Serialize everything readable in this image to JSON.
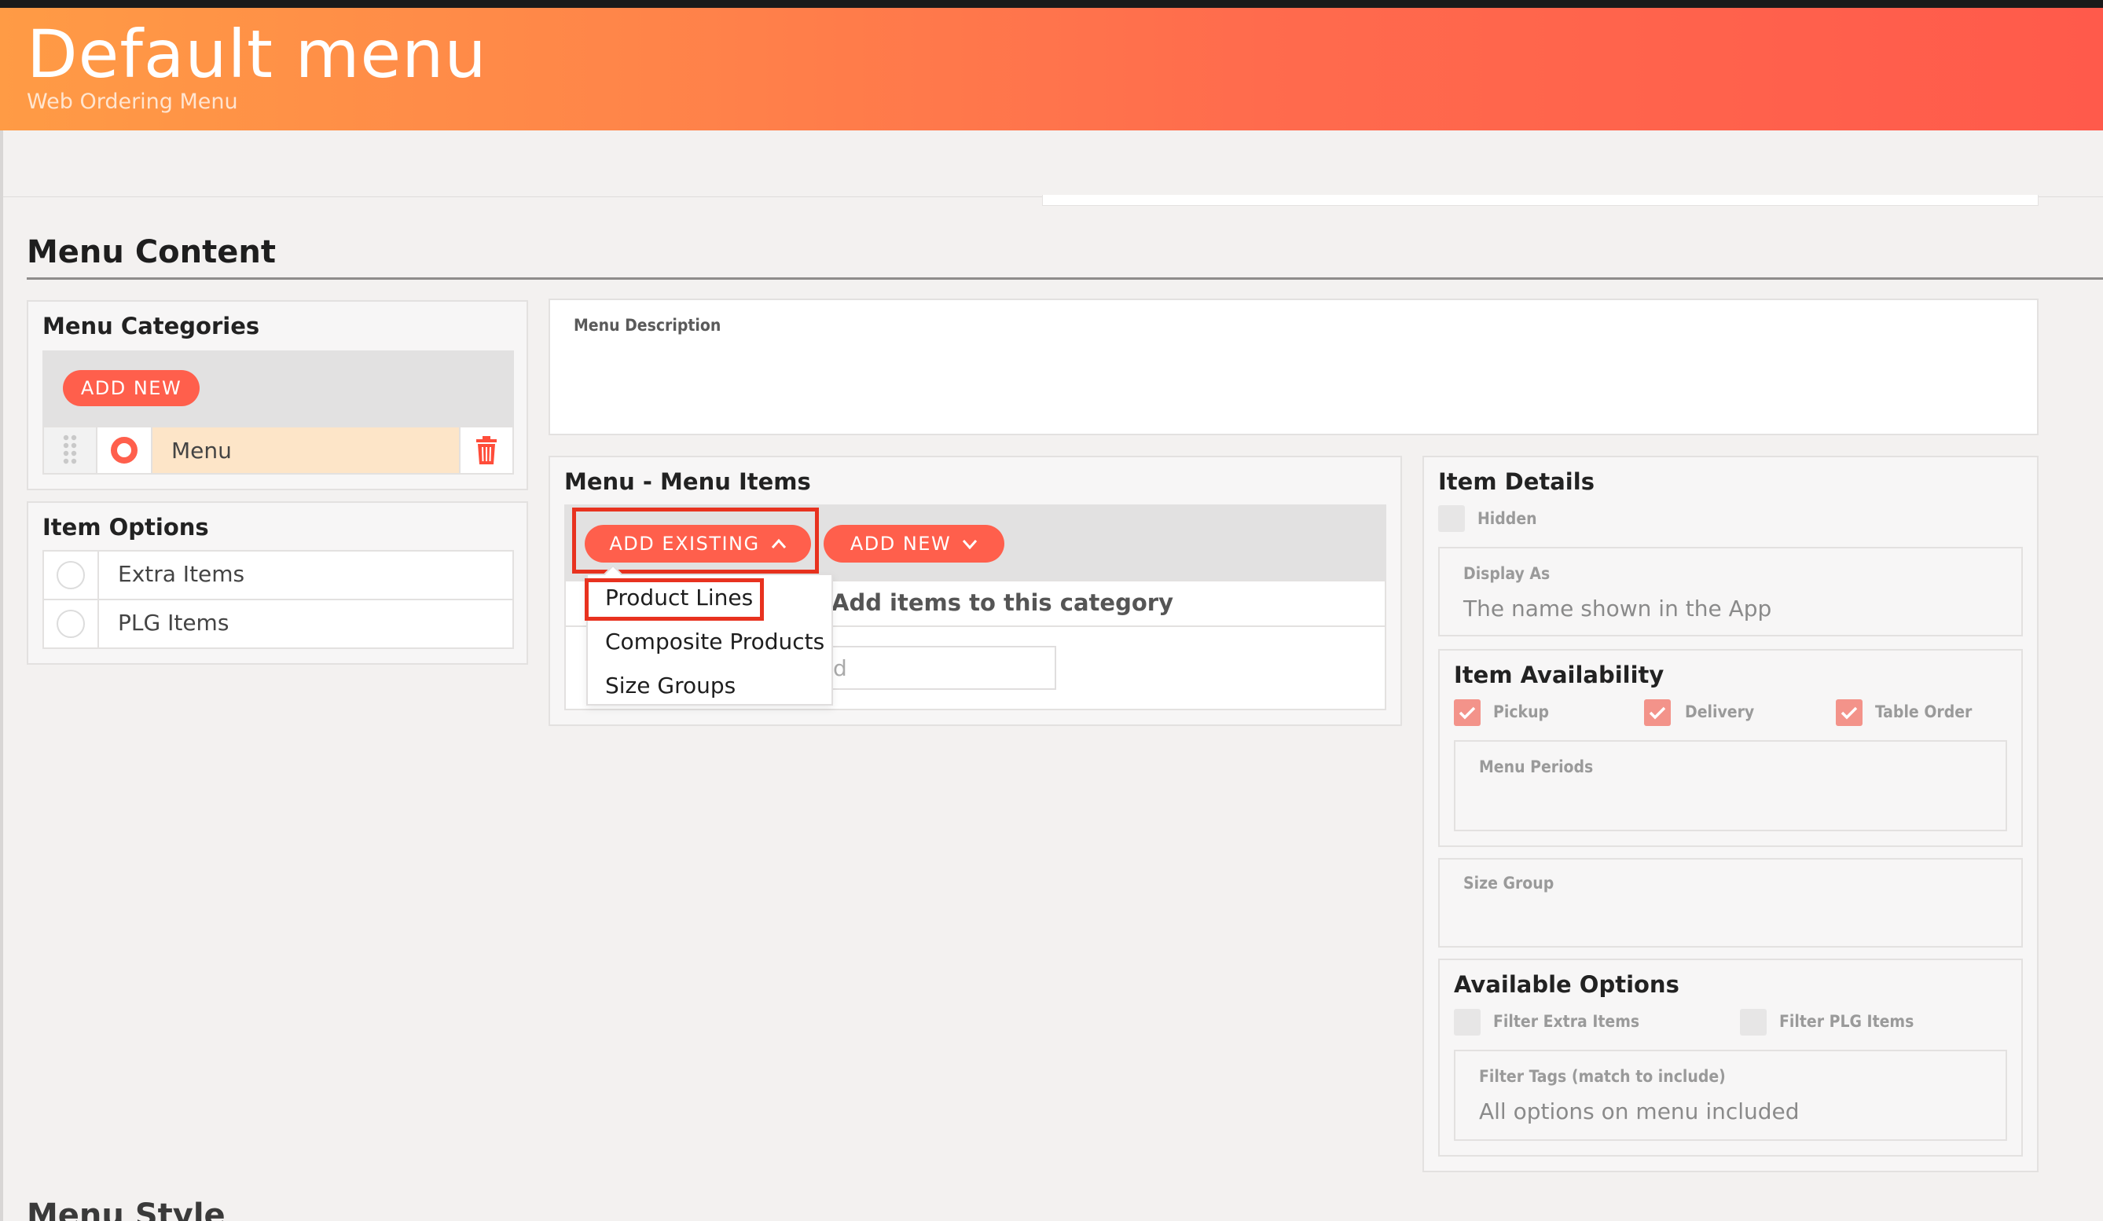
{
  "header": {
    "title": "Default menu",
    "subtitle": "Web Ordering Menu"
  },
  "section": {
    "title": "Menu Content",
    "next_title": "Menu Style"
  },
  "categories": {
    "title": "Menu Categories",
    "add_new": "ADD NEW",
    "items": [
      {
        "label": "Menu"
      }
    ]
  },
  "item_options": {
    "title": "Item Options",
    "items": [
      {
        "label": "Extra Items"
      },
      {
        "label": "PLG Items"
      }
    ]
  },
  "description": {
    "label": "Menu Description"
  },
  "menu_items": {
    "title": "Menu - Menu Items",
    "add_existing": "ADD EXISTING",
    "add_new": "ADD NEW",
    "empty_text": "Add items to this category",
    "search_fragment": "d",
    "dropdown": [
      "Product Lines",
      "Composite Products",
      "Size Groups"
    ]
  },
  "item_details": {
    "title": "Item Details",
    "hidden_label": "Hidden",
    "display_as_label": "Display As",
    "display_as_placeholder": "The name shown in the App",
    "availability": {
      "title": "Item Availability",
      "pickup": "Pickup",
      "delivery": "Delivery",
      "table_order": "Table Order",
      "menu_periods_label": "Menu Periods"
    },
    "size_group_label": "Size Group",
    "available_options": {
      "title": "Available Options",
      "filter_extra": "Filter Extra Items",
      "filter_plg": "Filter PLG Items",
      "filter_tags_label": "Filter Tags (match to include)",
      "filter_tags_value": "All options on menu included"
    }
  },
  "colors": {
    "accent": "#ff5f4c",
    "highlight": "#e8321f",
    "selected_row": "#fde5c8"
  }
}
